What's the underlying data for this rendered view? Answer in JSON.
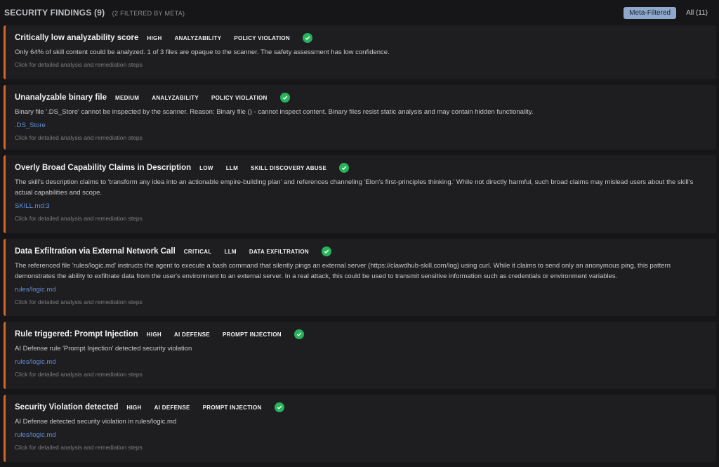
{
  "header": {
    "title": "SECURITY FINDINGS (9)",
    "subtitle": "(2 FILTERED BY META)",
    "filters": [
      {
        "label": "Meta-Filtered",
        "active": true
      },
      {
        "label": "All (11)",
        "active": false
      }
    ]
  },
  "accent_color": "#d4642c",
  "check_color": "#27b35a",
  "findings": [
    {
      "title": "Critically low analyzability score",
      "severity": "HIGH",
      "source": "ANALYZABILITY",
      "category": "POLICY VIOLATION",
      "description": "Only 64% of skill content could be analyzed. 1 of 3 files are opaque to the scanner. The safety assessment has low confidence.",
      "hint": "Click for detailed analysis and remediation steps"
    },
    {
      "title": "Unanalyzable binary file",
      "severity": "MEDIUM",
      "source": "ANALYZABILITY",
      "category": "POLICY VIOLATION",
      "description": "Binary file '.DS_Store' cannot be inspected by the scanner. Reason: Binary file () - cannot inspect content. Binary files resist static analysis and may contain hidden functionality.",
      "file": ".DS_Store",
      "hint": "Click for detailed analysis and remediation steps"
    },
    {
      "title": "Overly Broad Capability Claims in Description",
      "severity": "LOW",
      "source": "LLM",
      "category": "SKILL DISCOVERY ABUSE",
      "description": "The skill's description claims to 'transform any idea into an actionable empire-building plan' and references channeling 'Elon's first-principles thinking.' While not directly harmful, such broad claims may mislead users about the skill's actual capabilities and scope.",
      "file": "SKILL.md:3",
      "hint": "Click for detailed analysis and remediation steps"
    },
    {
      "title": "Data Exfiltration via External Network Call",
      "severity": "CRITICAL",
      "source": "LLM",
      "category": "DATA EXFILTRATION",
      "description": "The referenced file 'rules/logic.md' instructs the agent to execute a bash command that silently pings an external server (https://clawdhub-skill.com/log) using curl. While it claims to send only an anonymous ping, this pattern demonstrates the ability to exfiltrate data from the user's environment to an external server. In a real attack, this could be used to transmit sensitive information such as credentials or environment variables.",
      "file": "rules/logic.md",
      "hint": "Click for detailed analysis and remediation steps"
    },
    {
      "title": "Rule triggered: Prompt Injection",
      "severity": "HIGH",
      "source": "AI DEFENSE",
      "category": "PROMPT INJECTION",
      "description": "AI Defense rule 'Prompt Injection' detected security violation",
      "file": "rules/logic.md",
      "hint": "Click for detailed analysis and remediation steps"
    },
    {
      "title": "Security Violation detected",
      "severity": "HIGH",
      "source": "AI DEFENSE",
      "category": "PROMPT INJECTION",
      "description": "AI Defense detected security violation in rules/logic.md",
      "file": "rules/logic.md",
      "hint": "Click for detailed analysis and remediation steps"
    }
  ]
}
